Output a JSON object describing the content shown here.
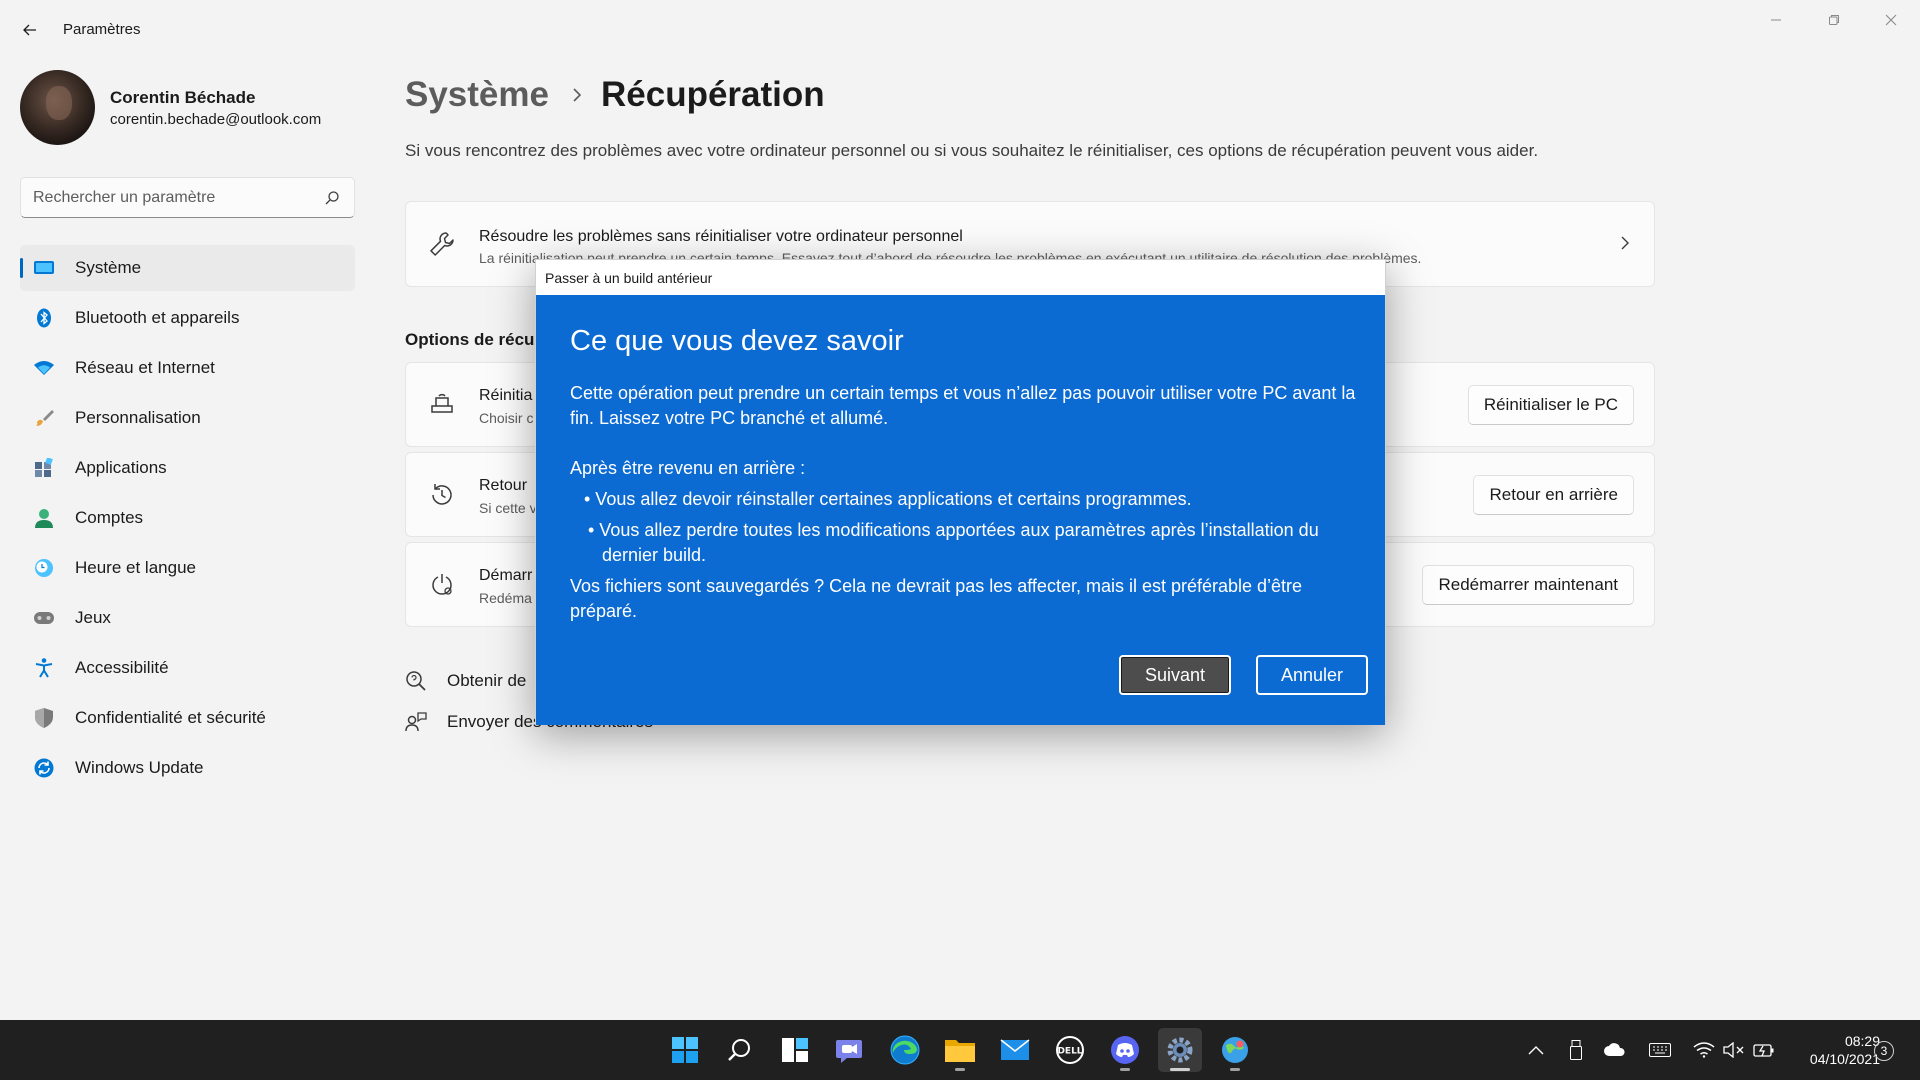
{
  "window": {
    "title": "Paramètres",
    "controls": [
      "minimize",
      "restore",
      "close"
    ]
  },
  "profile": {
    "name": "Corentin Béchade",
    "email": "corentin.bechade@outlook.com"
  },
  "search": {
    "placeholder": "Rechercher un paramètre",
    "value": ""
  },
  "sidebar": {
    "items": [
      {
        "label": "Système",
        "icon": "system-icon",
        "active": true
      },
      {
        "label": "Bluetooth et appareils",
        "icon": "bluetooth-icon"
      },
      {
        "label": "Réseau et Internet",
        "icon": "wifi-icon"
      },
      {
        "label": "Personnalisation",
        "icon": "brush-icon"
      },
      {
        "label": "Applications",
        "icon": "apps-icon"
      },
      {
        "label": "Comptes",
        "icon": "account-icon"
      },
      {
        "label": "Heure et langue",
        "icon": "clock-globe-icon"
      },
      {
        "label": "Jeux",
        "icon": "gamepad-icon"
      },
      {
        "label": "Accessibilité",
        "icon": "accessibility-icon"
      },
      {
        "label": "Confidentialité et sécurité",
        "icon": "shield-icon"
      },
      {
        "label": "Windows Update",
        "icon": "update-icon"
      }
    ]
  },
  "breadcrumb": {
    "parent": "Système",
    "current": "Récupération"
  },
  "page": {
    "description": "Si vous rencontrez des problèmes avec votre ordinateur personnel ou si vous souhaitez le réinitialiser, ces options de récupération peuvent vous aider."
  },
  "troubleshoot": {
    "title": "Résoudre les problèmes sans réinitialiser votre ordinateur personnel",
    "subtitle": "La réinitialisation peut prendre un certain temps. Essayez tout d’abord de résoudre les problèmes en exécutant un utilitaire de résolution des problèmes."
  },
  "recovery": {
    "section_title": "Options de récup",
    "options": [
      {
        "title": "Réinitia",
        "subtitle": "Choisir c",
        "button": "Réinitialiser le PC",
        "icon": "reset-pc-icon"
      },
      {
        "title": "Retour",
        "subtitle": "Si cette v",
        "button": "Retour en arrière",
        "icon": "history-icon"
      },
      {
        "title": "Démarr",
        "subtitle": "Redéma",
        "button": "Redémarrer maintenant",
        "icon": "advanced-startup-icon"
      }
    ]
  },
  "links": {
    "help": "Obtenir de",
    "feedback": "Envoyer des commentaires"
  },
  "dialog": {
    "title": "Passer à un build antérieur",
    "heading": "Ce que vous devez savoir",
    "intro": "Cette opération peut prendre un certain temps et vous n’allez pas pouvoir utiliser votre PC avant la fin. Laissez votre PC branché et allumé.",
    "after_label": "Après être revenu en arrière :",
    "bullet1": "•  Vous allez devoir réinstaller certaines applications et certains programmes.",
    "bullet2": "• Vous allez perdre toutes les modifications apportées aux paramètres après l’installation du dernier build.",
    "backup_note": "Vos fichiers sont sauvegardés ? Cela ne devrait pas les affecter, mais il est préférable d’être préparé.",
    "next_label": "Suivant",
    "cancel_label": "Annuler"
  },
  "taskbar": {
    "apps": [
      "start-icon",
      "search-icon",
      "task-view-icon",
      "chat-icon",
      "edge-icon",
      "file-explorer-icon",
      "mail-icon",
      "dell-icon",
      "discord-icon",
      "settings-icon",
      "maps-icon"
    ],
    "time": "08:29",
    "date": "04/10/2021",
    "notification_count": "3"
  },
  "colors": {
    "accent": "#0067c0",
    "dialog_blue": "#0c6ad3",
    "taskbar": "#202020"
  }
}
